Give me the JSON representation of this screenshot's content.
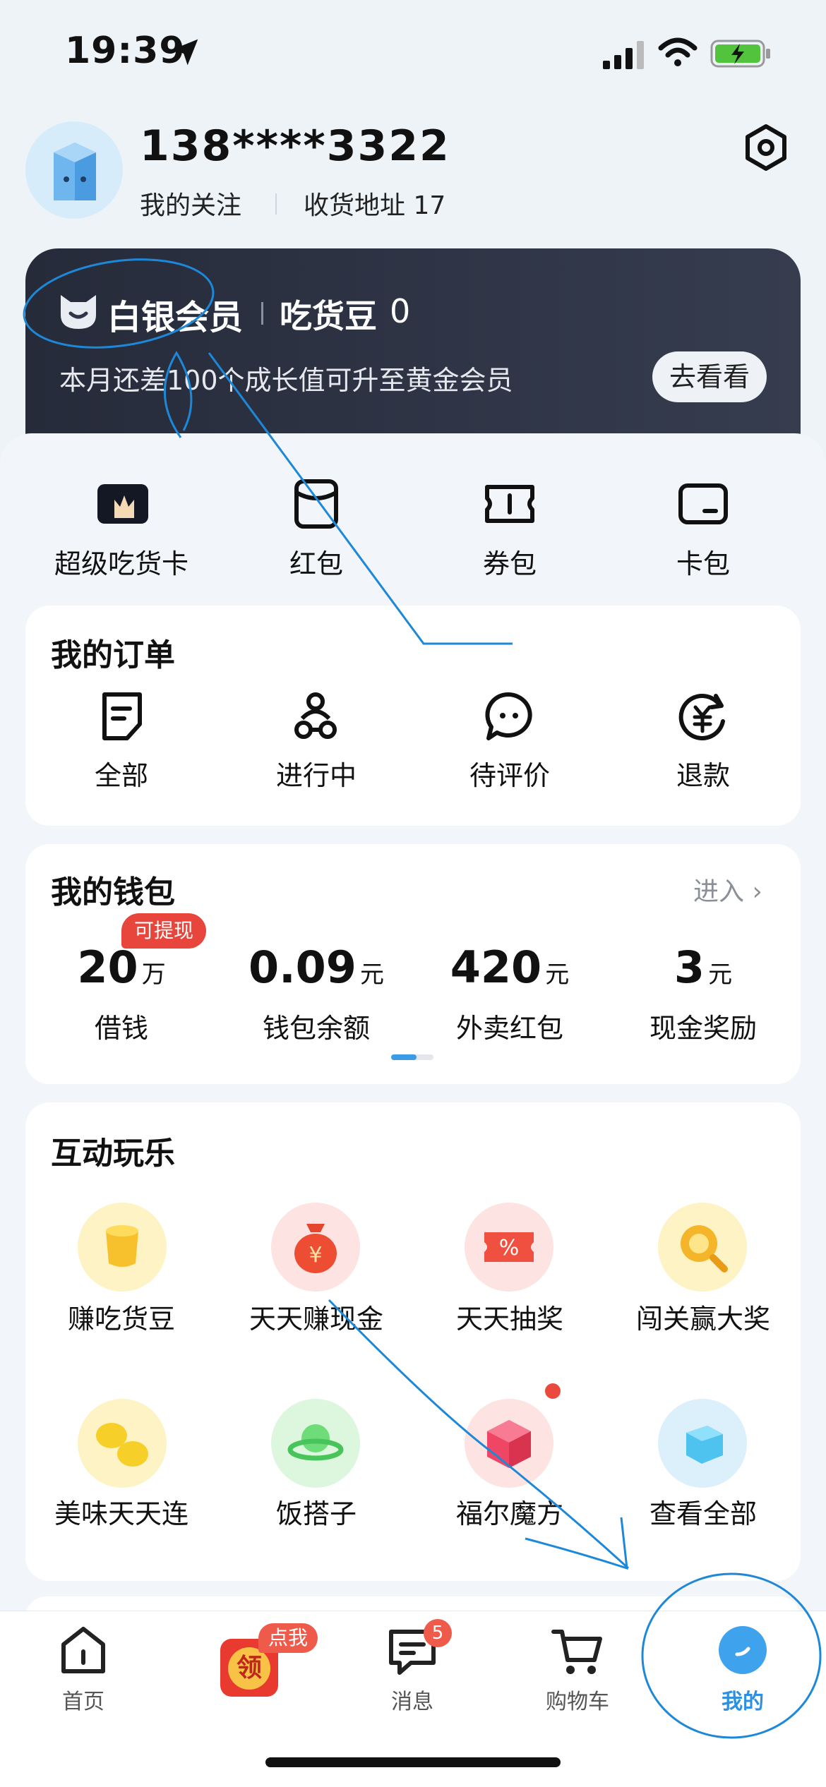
{
  "status_bar": {
    "time": "19:39"
  },
  "profile": {
    "phone": "138****3322",
    "follow_label": "我的关注",
    "address_label": "收货地址 17"
  },
  "member_card": {
    "level": "白银会员",
    "bean_label": "吃货豆",
    "bean_value": "0",
    "description": "本月还差100个成长值可升至黄金会员",
    "button": "去看看"
  },
  "quick_actions": [
    {
      "label": "超级吃货卡",
      "icon": "super-foodie-card-icon"
    },
    {
      "label": "红包",
      "icon": "red-packet-icon"
    },
    {
      "label": "券包",
      "icon": "coupon-icon"
    },
    {
      "label": "卡包",
      "icon": "card-wallet-icon"
    }
  ],
  "orders": {
    "title": "我的订单",
    "items": [
      {
        "label": "全部",
        "icon": "all-orders-icon"
      },
      {
        "label": "进行中",
        "icon": "delivery-rider-icon"
      },
      {
        "label": "待评价",
        "icon": "comment-icon"
      },
      {
        "label": "退款",
        "icon": "refund-icon"
      }
    ]
  },
  "wallet": {
    "title": "我的钱包",
    "enter": "进入 ›",
    "badge": "可提现",
    "items": [
      {
        "value": "20",
        "unit": "万",
        "label": "借钱"
      },
      {
        "value": "0.09",
        "unit": "元",
        "label": "钱包余额"
      },
      {
        "value": "420",
        "unit": "元",
        "label": "外卖红包"
      },
      {
        "value": "3",
        "unit": "元",
        "label": "现金奖励"
      }
    ]
  },
  "games": {
    "title": "互动玩乐",
    "items": [
      {
        "label": "赚吃货豆",
        "icon": "foodie-bean-icon",
        "color": "#fdf3c4"
      },
      {
        "label": "天天赚现金",
        "icon": "money-bag-icon",
        "color": "#fde3e1"
      },
      {
        "label": "天天抽奖",
        "icon": "lottery-ticket-icon",
        "color": "#fde3e1"
      },
      {
        "label": "闯关赢大奖",
        "icon": "magnifier-coin-icon",
        "color": "#fdf3c4"
      },
      {
        "label": "美味天天连",
        "icon": "lemon-icon",
        "color": "#fdf3c4"
      },
      {
        "label": "饭搭子",
        "icon": "planet-icon",
        "color": "#dcf7de"
      },
      {
        "label": "福尔魔方",
        "icon": "cube-icon",
        "color": "#fde3e1"
      },
      {
        "label": "查看全部",
        "icon": "view-all-cube-icon",
        "color": "#dbf0fb"
      }
    ]
  },
  "tab_bar": {
    "items": [
      {
        "label": "首页",
        "icon": "home-icon"
      },
      {
        "label": "",
        "icon": "claim-coupon-icon",
        "badge": "点我",
        "badge_text": "领"
      },
      {
        "label": "消息",
        "icon": "message-icon",
        "badge": "5"
      },
      {
        "label": "购物车",
        "icon": "cart-icon"
      },
      {
        "label": "我的",
        "icon": "profile-icon",
        "active": true
      }
    ]
  },
  "colors": {
    "accent": "#3a8ee6",
    "badge_red": "#e8463c",
    "member_bg": "#2b3040"
  }
}
